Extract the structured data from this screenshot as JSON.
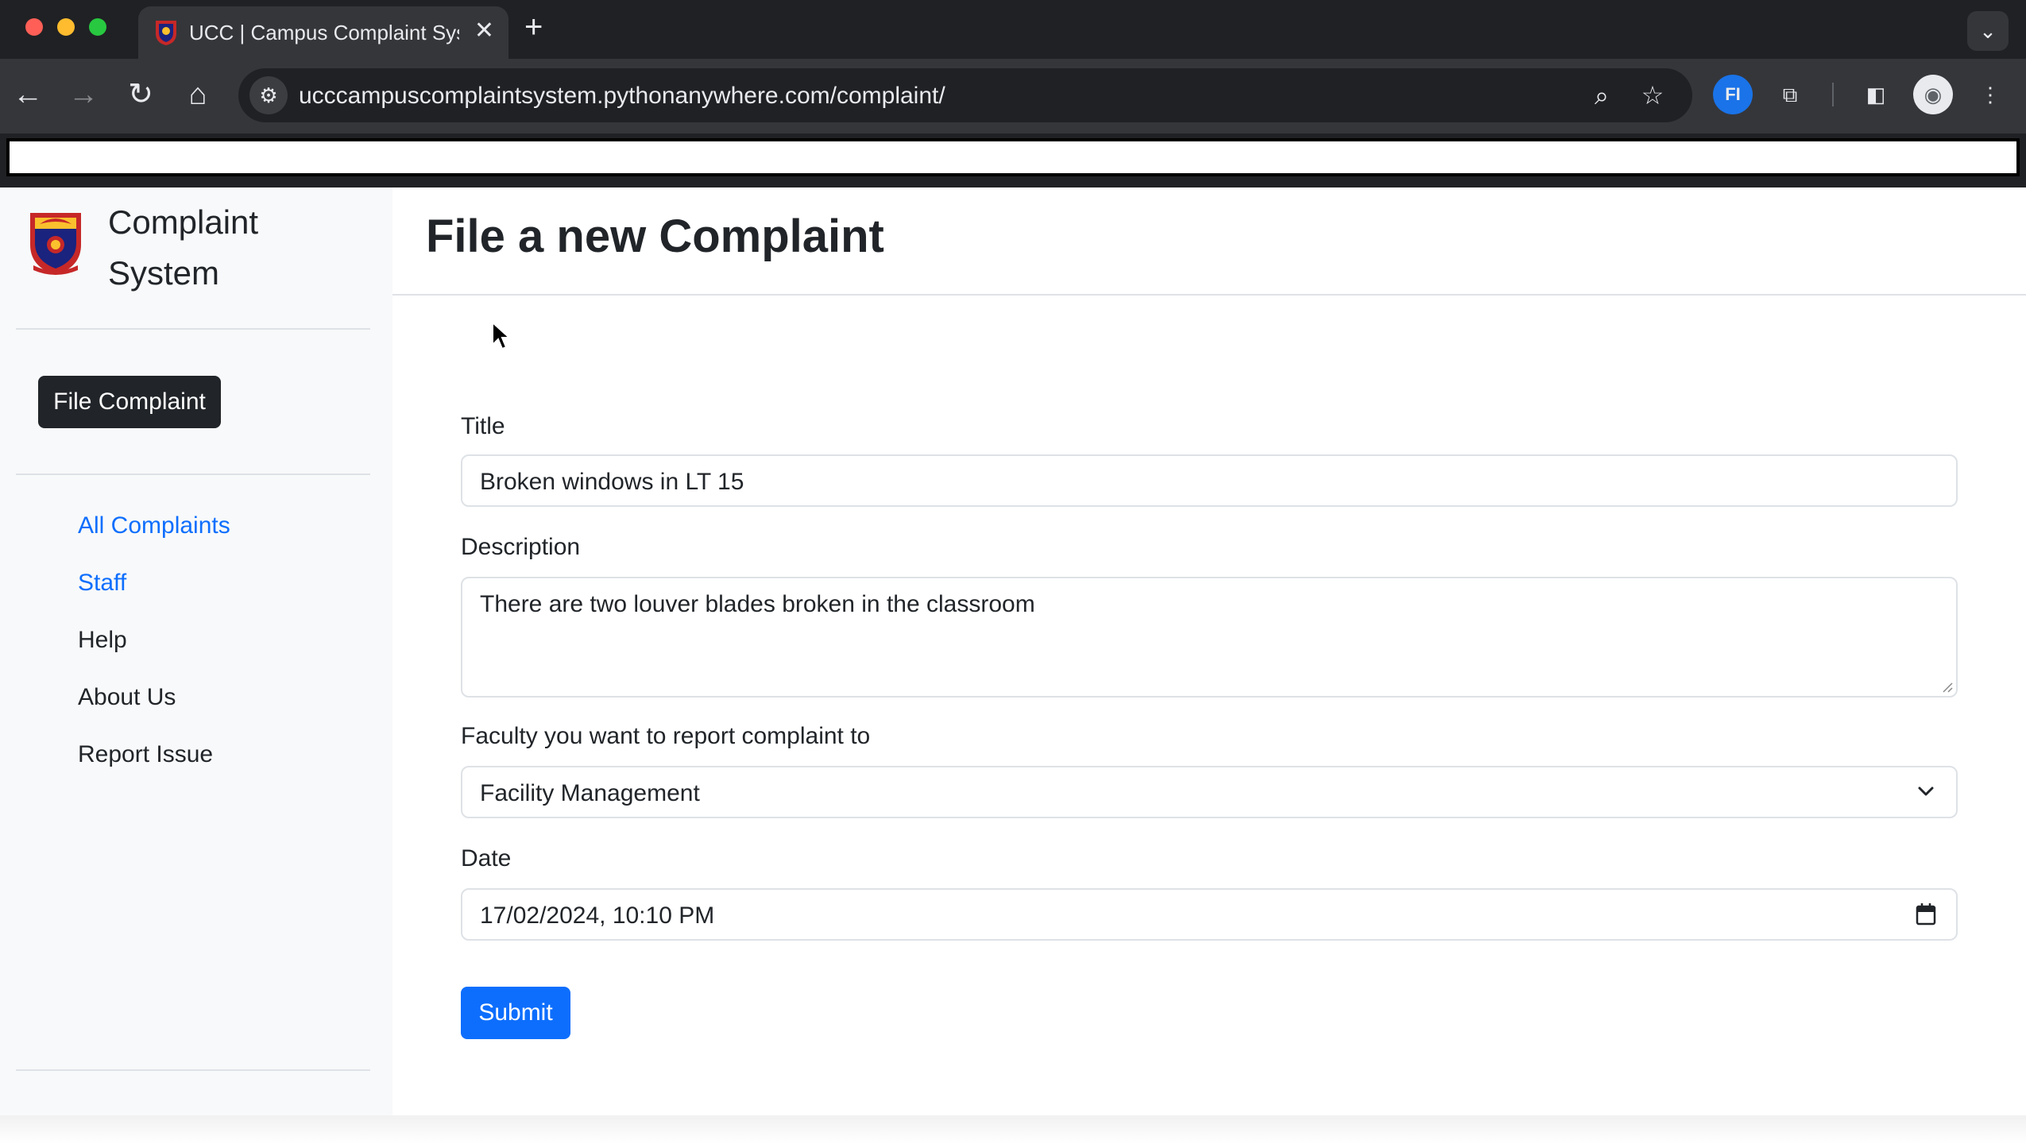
{
  "browser": {
    "tab_title": "UCC | Campus Complaint System",
    "tab_close_glyph": "✕",
    "new_tab_glyph": "+",
    "tab_list_glyph": "⌄",
    "url": "ucccampuscomplaintsystem.pythonanywhere.com/complaint/",
    "icons": [
      "back-icon",
      "forward-icon",
      "reload-icon",
      "home-icon",
      "site-info-icon",
      "zoom-icon",
      "bookmark-star-icon",
      "extension-fi-icon",
      "puzzle-extensions-icon",
      "side-panel-icon",
      "profile-avatar-icon",
      "kebab-menu-icon"
    ],
    "glyphs": {
      "back": "←",
      "forward": "→",
      "reload": "↻",
      "home": "⌂",
      "site_info": "⚙",
      "zoom": "⌕",
      "star": "☆",
      "ext_fi": "FI",
      "puzzle": "⧉",
      "side_panel": "◧",
      "avatar": "◉",
      "menu": "⋮"
    }
  },
  "sidebar": {
    "brand": "Complaint System",
    "file_button": "File Complaint",
    "nav": [
      {
        "label": "All Complaints",
        "active": true
      },
      {
        "label": "Staff",
        "active": true
      },
      {
        "label": "Help",
        "active": false
      },
      {
        "label": "About Us",
        "active": false
      },
      {
        "label": "Report Issue",
        "active": false
      }
    ]
  },
  "main": {
    "heading": "File a new Complaint",
    "form": {
      "title_label": "Title",
      "title_value": "Broken windows in LT 15",
      "description_label": "Description",
      "description_value": "There are two louver blades broken in the classroom",
      "faculty_label": "Faculty you want to report complaint to",
      "faculty_value": "Facility Management",
      "date_label": "Date",
      "date_value": "17/02/2024, 10:10  PM",
      "submit_label": "Submit"
    }
  },
  "colors": {
    "primary": "#0d6efd",
    "dark": "#212529",
    "sidebar_bg": "#f8f9fa",
    "chrome_dark": "#202124",
    "chrome_toolbar": "#35363a"
  }
}
